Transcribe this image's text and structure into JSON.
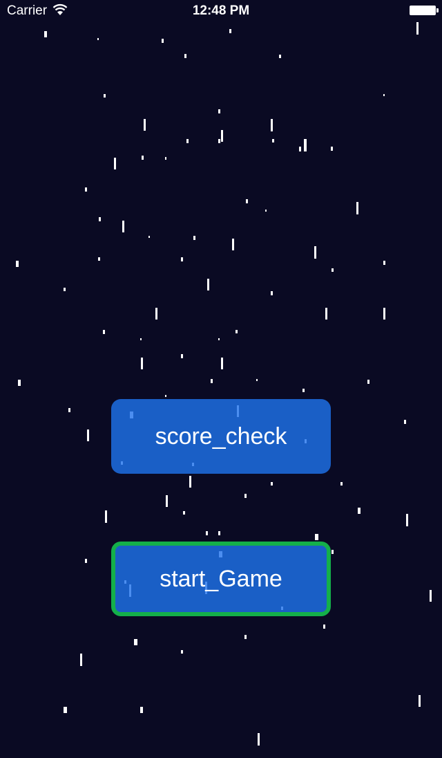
{
  "status_bar": {
    "carrier": "Carrier",
    "time": "12:48 PM"
  },
  "menu": {
    "score_check_label": "score_check",
    "start_game_label": "start_Game"
  },
  "colors": {
    "background": "#0a0a23",
    "button": "#1a5fc6",
    "focus_border": "#14b04a",
    "star": "#ffffff"
  }
}
